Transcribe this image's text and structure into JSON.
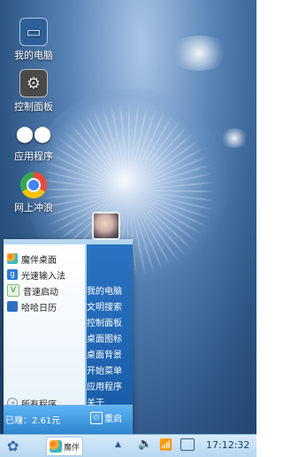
{
  "desktop": {
    "icons": [
      {
        "label": "我的电脑",
        "icon": "computer-icon"
      },
      {
        "label": "控制面板",
        "icon": "gear-icon"
      },
      {
        "label": "应用程序",
        "icon": "apps-grid-icon"
      },
      {
        "label": "网上冲浪",
        "icon": "chrome-icon"
      }
    ]
  },
  "start_menu": {
    "left_items": [
      {
        "label": "魔伴桌面",
        "icon": "mobo-icon"
      },
      {
        "label": "光速输入法",
        "icon": "input-g-icon"
      },
      {
        "label": "音速启动",
        "icon": "v-launch-icon"
      },
      {
        "label": "哈哈日历",
        "icon": "calendar-icon"
      }
    ],
    "all_programs": "所有程序",
    "right_items": [
      "我的电脑",
      "文明搜索",
      "控制面板",
      "桌面图标",
      "桌面背景",
      "开始菜单",
      "应用程序",
      "关于"
    ],
    "earned": "已赚：2.61元",
    "restart": "重启"
  },
  "taskbar": {
    "app_label": "魔伴",
    "time": "17:12:32"
  },
  "colors": {
    "taskbar_bg": "#c7e2f7",
    "menu_blue": "#1a5ea9"
  }
}
